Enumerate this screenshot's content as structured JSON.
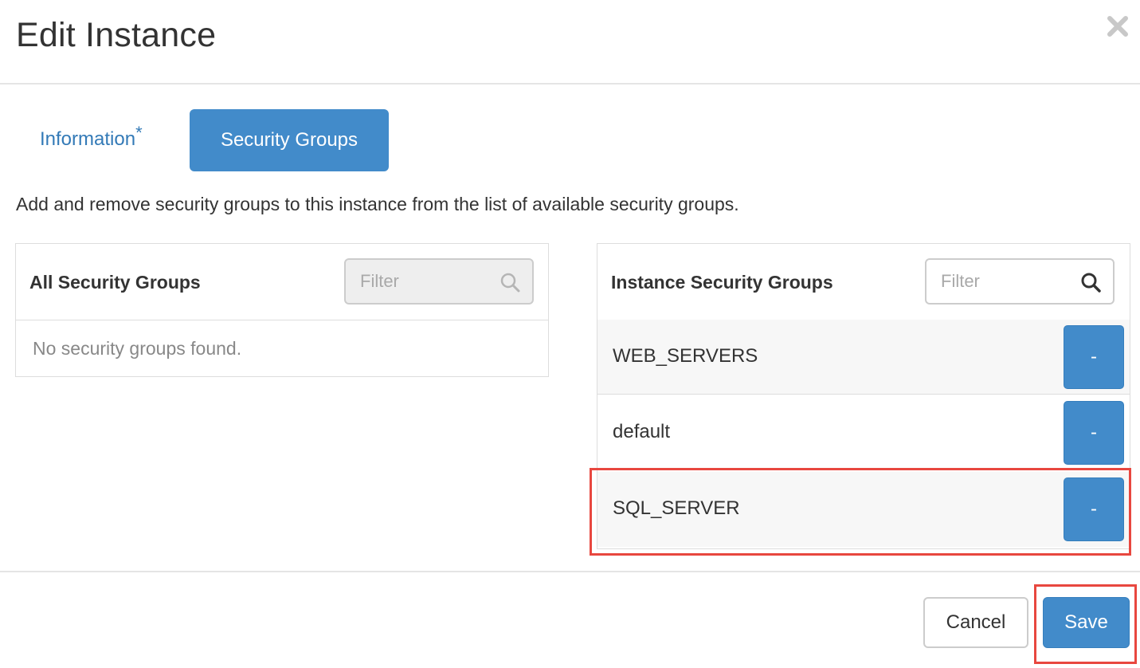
{
  "modal": {
    "title": "Edit Instance",
    "close_icon": "close-icon"
  },
  "tabs": [
    {
      "label": "Information",
      "required_marker": "*",
      "active": false
    },
    {
      "label": "Security Groups",
      "active": true
    }
  ],
  "description": "Add and remove security groups to this instance from the list of available security groups.",
  "available_panel": {
    "title": "All Security Groups",
    "filter_placeholder": "Filter",
    "filter_disabled": true,
    "empty_message": "No security groups found."
  },
  "instance_panel": {
    "title": "Instance Security Groups",
    "filter_placeholder": "Filter",
    "items": [
      {
        "name": "WEB_SERVERS",
        "action_label": "-"
      },
      {
        "name": "default",
        "action_label": "-"
      },
      {
        "name": "SQL_SERVER",
        "action_label": "-"
      }
    ]
  },
  "footer": {
    "cancel_label": "Cancel",
    "save_label": "Save"
  },
  "colors": {
    "primary": "#428bca",
    "link": "#337ab7",
    "highlight": "#e8473f"
  }
}
